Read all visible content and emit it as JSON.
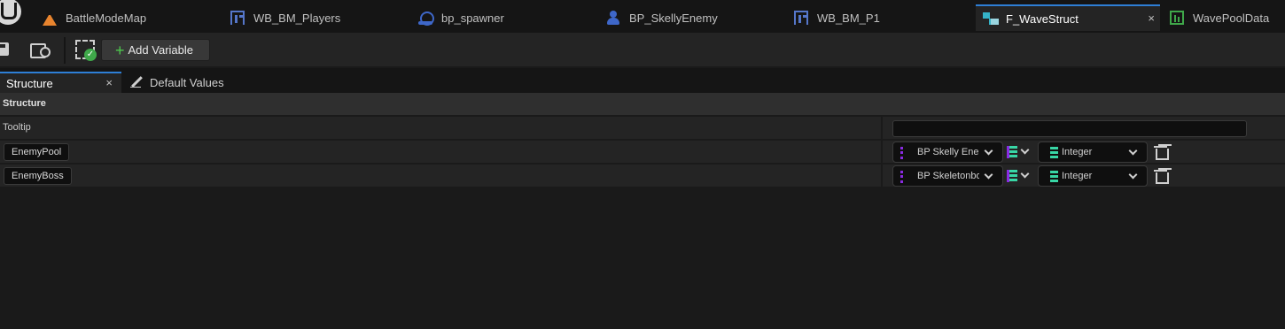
{
  "tabs": [
    {
      "label": "BattleModeMap",
      "icon": "map-icon",
      "active": false
    },
    {
      "label": "WB_BM_Players",
      "icon": "widget-blueprint-icon",
      "active": false
    },
    {
      "label": "bp_spawner",
      "icon": "spawner-blueprint-icon",
      "active": false
    },
    {
      "label": "BP_SkellyEnemy",
      "icon": "character-blueprint-icon",
      "active": false
    },
    {
      "label": "WB_BM_P1",
      "icon": "widget-blueprint-icon",
      "active": false
    },
    {
      "label": "F_WaveStruct",
      "icon": "struct-icon",
      "active": true,
      "close": "×"
    },
    {
      "label": "WavePoolData",
      "icon": "data-asset-icon",
      "active": false
    }
  ],
  "toolbar": {
    "add_variable_label": "Add Variable",
    "plus": "+"
  },
  "panel_tabs": {
    "structure_label": "Structure",
    "close": "×",
    "default_values_label": "Default Values"
  },
  "details": {
    "section_title": "Structure",
    "tooltip_label": "Tooltip",
    "tooltip_value": "",
    "variables": [
      {
        "name": "EnemyPool",
        "type": "BP Skelly Enemy",
        "value_type": "Integer"
      },
      {
        "name": "EnemyBoss",
        "type": "BP Skeletonboss",
        "value_type": "Integer"
      }
    ]
  },
  "colors": {
    "accent": "#2e7fd6",
    "object_type": "#8a2be2",
    "integer_type": "#38d6a5",
    "add_icon": "#4ec94e"
  }
}
